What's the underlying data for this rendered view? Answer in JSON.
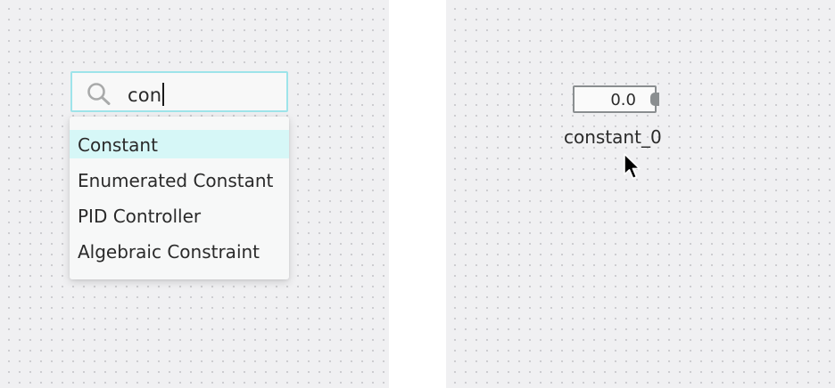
{
  "search": {
    "query": "con",
    "icon": "search-icon"
  },
  "dropdown": {
    "items": [
      {
        "label": "Constant",
        "selected": true
      },
      {
        "label": "Enumerated Constant",
        "selected": false
      },
      {
        "label": "PID Controller",
        "selected": false
      },
      {
        "label": "Algebraic Constraint",
        "selected": false
      }
    ]
  },
  "block": {
    "value": "0.0",
    "name": "constant_0"
  },
  "colors": {
    "canvas": "#f0f0f2",
    "accent_border": "#9ee4ea",
    "selected_item": "#d6f7f7",
    "block_border": "#8a8e90",
    "text": "#2a2a2a"
  }
}
